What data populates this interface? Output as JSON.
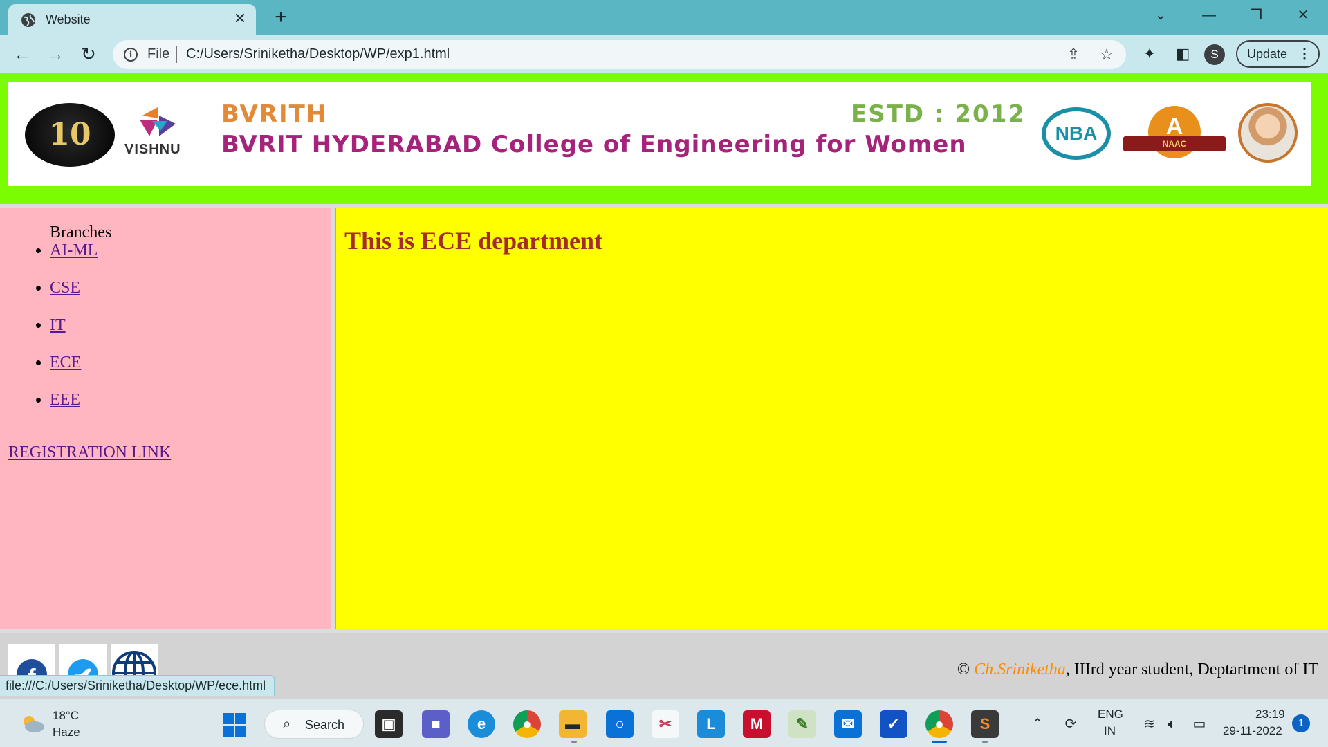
{
  "browser": {
    "tab_title": "Website",
    "tab_close": "✕",
    "new_tab": "+",
    "omnibox_scheme": "File",
    "url": "C:/Users/Sriniketha/Desktop/WP/exp1.html",
    "profile_initial": "S",
    "update_label": "Update",
    "status_url": "file:///C:/Users/Sriniketha/Desktop/WP/ece.html"
  },
  "banner": {
    "anniversary": "10",
    "vishnu": "VISHNU",
    "short_name": "BVRITH",
    "established": "ESTD : 2012",
    "college_name": "BVRIT HYDERABAD College of Engineering for Women",
    "nba": "NBA",
    "naac_grade": "A",
    "naac_label": "NAAC"
  },
  "sidebar": {
    "heading": "Branches",
    "branches": [
      "AI-ML",
      "CSE",
      "IT",
      "ECE",
      "EEE"
    ],
    "registration_link": "REGISTRATION LINK"
  },
  "main": {
    "heading": "This is ECE department"
  },
  "footer": {
    "copyright_symbol": "©",
    "author": "Ch.Sriniketha",
    "rest": ", IIIrd year student, Deptartment of IT"
  },
  "taskbar": {
    "temperature": "18°C",
    "weather": "Haze",
    "search_label": "Search",
    "language": "ENG",
    "region": "IN",
    "time": "23:19",
    "date": "29-11-2022",
    "notifications": "1"
  },
  "colors": {
    "header_bg": "#7cfc00",
    "sidebar_bg": "#ffb6c1",
    "main_bg": "#ffff00",
    "heading_color": "#a52a2a",
    "author_color": "#ff8c00",
    "footer_bg": "#d3d3d3"
  }
}
